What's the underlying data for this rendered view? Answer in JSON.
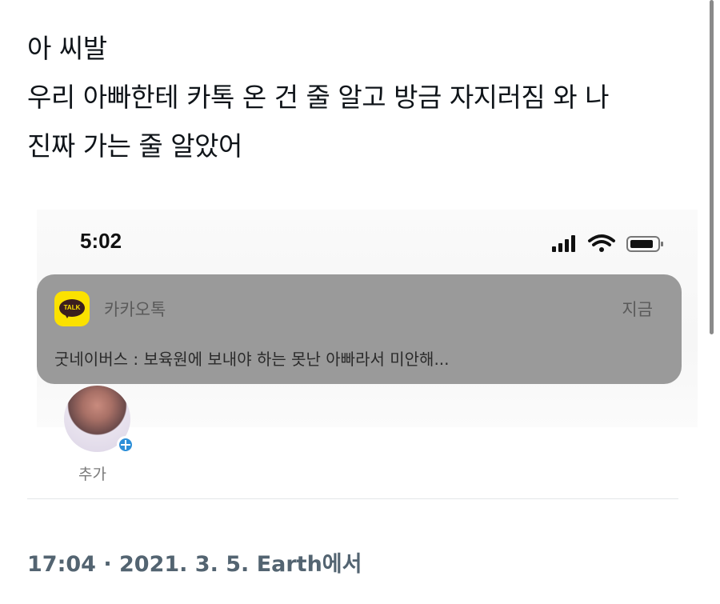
{
  "tweet": {
    "lines": [
      "아 씨발",
      "우리 아빠한테 카톡 온 건 줄 알고 방금 자지러짐 와 나",
      "진짜 가는 줄 알았어"
    ]
  },
  "embedded_screenshot": {
    "status_bar": {
      "time": "5:02",
      "icons": [
        "signal-icon",
        "wifi-icon",
        "battery-icon"
      ]
    },
    "notification": {
      "app_icon": "kakaotalk-icon",
      "app_icon_text": "TALK",
      "app_name": "카카오톡",
      "time": "지금",
      "message": "굿네이버스 : 보육원에 보내야 하는 못난 아빠라서 미안해..."
    },
    "profile": {
      "add_label": "추가"
    }
  },
  "footer": {
    "meta": "17:04 · 2021. 3. 5. Earth에서"
  },
  "colors": {
    "notification_bg": "#9a9a9a",
    "kakao_yellow": "#fbe100",
    "meta_text": "#536471"
  }
}
